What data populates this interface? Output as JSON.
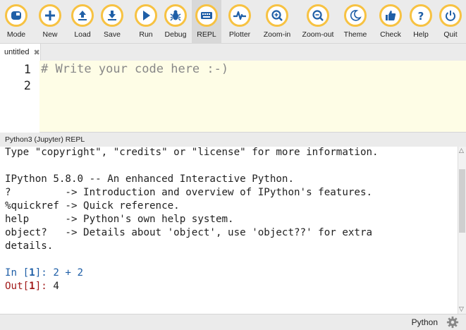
{
  "toolbar": {
    "buttons": [
      {
        "label": "Mode",
        "icon": "mode-icon"
      },
      {
        "label": "New",
        "icon": "plus-icon"
      },
      {
        "label": "Load",
        "icon": "upload-icon"
      },
      {
        "label": "Save",
        "icon": "download-icon"
      },
      {
        "label": "Run",
        "icon": "play-icon"
      },
      {
        "label": "Debug",
        "icon": "bug-icon"
      },
      {
        "label": "REPL",
        "icon": "keyboard-icon"
      },
      {
        "label": "Plotter",
        "icon": "pulse-icon"
      },
      {
        "label": "Zoom-in",
        "icon": "zoom-in-icon"
      },
      {
        "label": "Zoom-out",
        "icon": "zoom-out-icon"
      },
      {
        "label": "Theme",
        "icon": "moon-icon"
      },
      {
        "label": "Check",
        "icon": "thumbs-up-icon"
      },
      {
        "label": "Help",
        "icon": "question-icon"
      },
      {
        "label": "Quit",
        "icon": "power-icon"
      }
    ],
    "accent": "#f7c242",
    "icon_color": "#1f5fa7"
  },
  "tab": {
    "label": "untitled",
    "close": "✖"
  },
  "editor": {
    "line_numbers": [
      "1",
      "2"
    ],
    "code_line1": "# Write your code here :-)"
  },
  "repl": {
    "title": "Python3 (Jupyter) REPL",
    "lines": {
      "l1": "Type \"copyright\", \"credits\" or \"license\" for more information.",
      "l2": "IPython 5.8.0 -- An enhanced Interactive Python.",
      "l3": "?         -> Introduction and overview of IPython's features.",
      "l4": "%quickref -> Quick reference.",
      "l5": "help      -> Python's own help system.",
      "l6": "object?   -> Details about 'object', use 'object??' for extra",
      "l7": "details."
    },
    "in_prompt": "In [",
    "in_num": "1",
    "in_close": "]: ",
    "in_code": "2 + 2",
    "out_prompt": "Out[",
    "out_num": "1",
    "out_close": "]: ",
    "out_value": "4"
  },
  "status": {
    "mode": "Python",
    "gear_icon": "gear-icon"
  }
}
